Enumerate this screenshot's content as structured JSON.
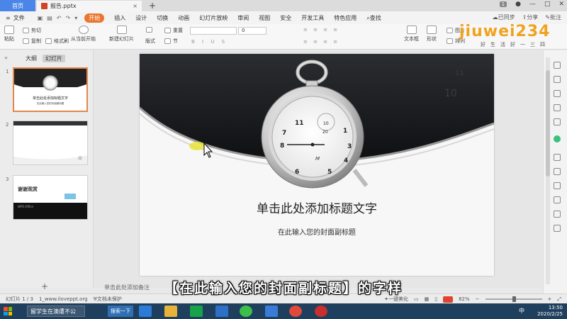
{
  "tabs": {
    "home": "首页",
    "doc": "报告.pptx",
    "badge": "1"
  },
  "menu": {
    "file": "文件",
    "items": [
      "开始",
      "插入",
      "设计",
      "切换",
      "动画",
      "幻灯片放映",
      "审阅",
      "视图",
      "安全",
      "开发工具",
      "特色应用"
    ],
    "search": "查找",
    "sync": "已同步",
    "share": "分享",
    "annotate": "批注"
  },
  "ribbon": {
    "paste": "粘贴",
    "cut": "剪切",
    "copy": "复制",
    "format_painter": "格式刷",
    "from_current": "从当前开始",
    "new_slide": "新建幻灯片",
    "layout": "版式",
    "section": "节",
    "reset": "重置",
    "font_size": "0",
    "textbox": "文本框",
    "shape": "形状",
    "picture": "图片",
    "arrange": "排列"
  },
  "watermark": {
    "logo": "jiuwei234",
    "tagline": "好生活好一三四"
  },
  "left_panel": {
    "outline_tab": "大纲",
    "slides_tab": "幻灯片",
    "slides": [
      {
        "num": "1",
        "title": "单击此处添加标题文字",
        "subtitle": "在此输入您的封面副标题"
      },
      {
        "num": "2"
      },
      {
        "num": "3",
        "thanks": "谢谢观赏",
        "office": "WPS Office"
      }
    ]
  },
  "slide": {
    "title": "单击此处添加标题文字",
    "subtitle": "在此输入您的封面副标题",
    "dial_numbers": [
      "11",
      "1",
      "2",
      "3",
      "4",
      "5",
      "6",
      "7",
      "8",
      "9",
      "10",
      "20"
    ]
  },
  "notes": {
    "placeholder": "单击此处添加备注"
  },
  "status": {
    "slide_count": "幻灯片 1 / 3",
    "template": "1_www.iloveppt.org",
    "protect": "文档未保护",
    "beautify": "一键美化",
    "zoom": "82%"
  },
  "caption": "【在此输入您的封面副标题】的字样",
  "taskbar": {
    "window": "留学生在澳遭不公",
    "search": "搜索一下",
    "time": "13:50",
    "date": "2020/2/25",
    "lang": "中"
  },
  "colors": {
    "accent": "#e9752f",
    "home_tab": "#4a86e8",
    "taskbar": "#1f3f5e",
    "selection": "#e2874c",
    "cursor_highlight": "#e8e33a"
  }
}
